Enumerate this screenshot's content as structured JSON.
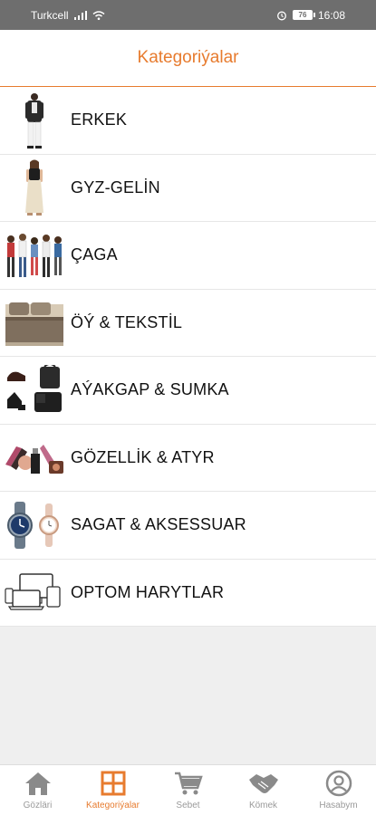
{
  "status_bar": {
    "carrier": "Turkcell",
    "battery": "76",
    "time": "16:08"
  },
  "header": {
    "title": "Kategoriýalar"
  },
  "categories": [
    {
      "label": "ERKEK",
      "icon": "man-clothing-icon"
    },
    {
      "label": "GYZ-GELİN",
      "icon": "woman-clothing-icon"
    },
    {
      "label": "ÇAGA",
      "icon": "children-icon"
    },
    {
      "label": "ÖÝ & TEKSTİL",
      "icon": "bedding-icon"
    },
    {
      "label": "AÝAKGAP & SUMKA",
      "icon": "shoes-bags-icon"
    },
    {
      "label": "GÖZELLİK & ATYR",
      "icon": "cosmetics-icon"
    },
    {
      "label": "SAGAT & AKSESSUAR",
      "icon": "watches-icon"
    },
    {
      "label": "OPTOM HARYTLAR",
      "icon": "devices-icon"
    }
  ],
  "bottom_nav": [
    {
      "label": "Gözläri",
      "icon": "home-icon",
      "active": false
    },
    {
      "label": "Kategoriýalar",
      "icon": "grid-icon",
      "active": true
    },
    {
      "label": "Sebet",
      "icon": "cart-icon",
      "active": false
    },
    {
      "label": "Kömek",
      "icon": "handshake-icon",
      "active": false
    },
    {
      "label": "Hasabym",
      "icon": "account-icon",
      "active": false
    }
  ],
  "colors": {
    "accent": "#e77b2e",
    "status_bar": "#6e6e6e",
    "inactive_icon": "#8a8a8a",
    "background_gray": "#efefef"
  }
}
